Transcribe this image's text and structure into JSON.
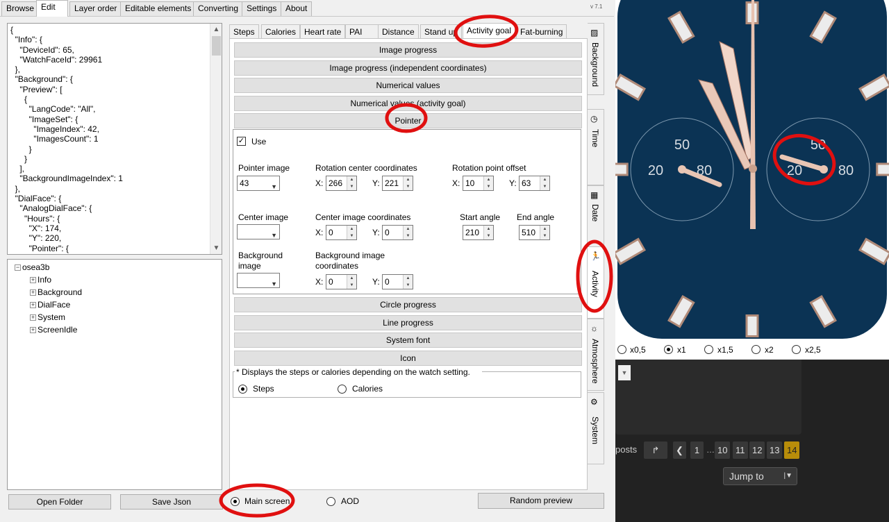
{
  "menu": {
    "tabs": [
      "Browse",
      "Edit",
      "Layer order",
      "Editable elements",
      "Converting",
      "Settings",
      "About"
    ],
    "active": "Edit",
    "version": "v 7.1"
  },
  "json_lines": [
    "{",
    "  \"Info\": {",
    "    \"DeviceId\": 65,",
    "    \"WatchFaceId\": 29961",
    "  },",
    "  \"Background\": {",
    "    \"Preview\": [",
    "      {",
    "        \"LangCode\": \"All\",",
    "        \"ImageSet\": {",
    "          \"ImageIndex\": 42,",
    "          \"ImagesCount\": 1",
    "        }",
    "      }",
    "    ],",
    "    \"BackgroundImageIndex\": 1",
    "  },",
    "  \"DialFace\": {",
    "    \"AnalogDialFace\": {",
    "      \"Hours\": {",
    "        \"X\": 174,",
    "        \"Y\": 220,",
    "        \"Pointer\": {"
  ],
  "tree": {
    "root": "osea3b",
    "children": [
      "Info",
      "Background",
      "DialFace",
      "System",
      "ScreenIdle"
    ]
  },
  "bottom": {
    "open_folder": "Open Folder",
    "save_json": "Save Json",
    "main_screen": "Main screen",
    "aod": "AOD",
    "random_preview": "Random preview"
  },
  "subtabs": [
    "Steps",
    "Calories",
    "Heart rate",
    "PAI",
    "Distance",
    "Stand up",
    "Activity goal",
    "Fat-burning"
  ],
  "subtab_active": "Activity goal",
  "sections_top": [
    "Image progress",
    "Image progress (independent coordinates)",
    "Numerical values",
    "Numerical values (activity goal)",
    "Pointer"
  ],
  "pointer": {
    "use_label": "Use",
    "pointer_image_label": "Pointer image",
    "pointer_image_value": "43",
    "rotation_center_label": "Rotation center coordinates",
    "rotation_x": "266",
    "rotation_y": "221",
    "rotation_offset_label": "Rotation point offset",
    "offset_x": "10",
    "offset_y": "63",
    "center_image_label": "Center image",
    "center_coords_label": "Center image coordinates",
    "center_x": "0",
    "center_y": "0",
    "start_angle_label": "Start angle",
    "start_angle": "210",
    "end_angle_label": "End angle",
    "end_angle": "510",
    "bg_image_label_1": "Background",
    "bg_image_label_2": "image",
    "bg_coords_label_1": "Background image",
    "bg_coords_label_2": "coordinates",
    "bg_x": "0",
    "bg_y": "0",
    "x_label": "X:",
    "y_label": "Y:"
  },
  "sections_bottom": [
    "Circle progress",
    "Line progress",
    "System font",
    "Icon"
  ],
  "note": {
    "text": "* Displays the steps or calories depending on the watch setting.",
    "steps": "Steps",
    "calories": "Calories"
  },
  "side_tabs": [
    "Background",
    "Time",
    "Date",
    "Activity",
    "Atmosphere",
    "System"
  ],
  "side_icons": [
    "background-icon",
    "clock-icon",
    "calendar-icon",
    "runner-icon",
    "weather-icon",
    "gear-icon"
  ],
  "zoom": {
    "options": [
      "x0,5",
      "x1",
      "x1,5",
      "x2",
      "x2,5"
    ],
    "selected": "x1"
  },
  "watch": {
    "subdial_top": "50",
    "subdial_left": "20",
    "subdial_right": "80",
    "dial_color": "#0b3354"
  },
  "forum": {
    "posts_label": "posts",
    "pages": [
      "1",
      "…",
      "10",
      "11",
      "12",
      "13",
      "14"
    ],
    "current_page": "14",
    "jump_to": "Jump to"
  },
  "colors": {
    "annotation_red": "#e01010",
    "page_active": "#b88d0a"
  }
}
